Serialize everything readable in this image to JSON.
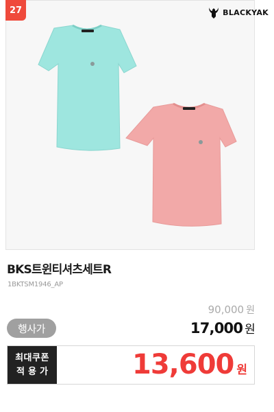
{
  "badge": {
    "rank": "27"
  },
  "brand": {
    "name": "BLACKYAK",
    "icon": "yak-head-icon"
  },
  "product": {
    "name": "BKS트윈티셔츠세트R",
    "code": "1BKTSM1946_AP",
    "colors": {
      "mint": "#9ee6df",
      "pink": "#f2a9a8"
    }
  },
  "pricing": {
    "original_price": "90,000",
    "original_unit": "원",
    "sale_label": "행사가",
    "sale_price": "17,000",
    "sale_unit": "원",
    "coupon_label_line1": "최대쿠폰",
    "coupon_label_line2": "적용가",
    "coupon_price": "13,600",
    "coupon_unit": "원",
    "accent_color": "#ef3b38"
  }
}
